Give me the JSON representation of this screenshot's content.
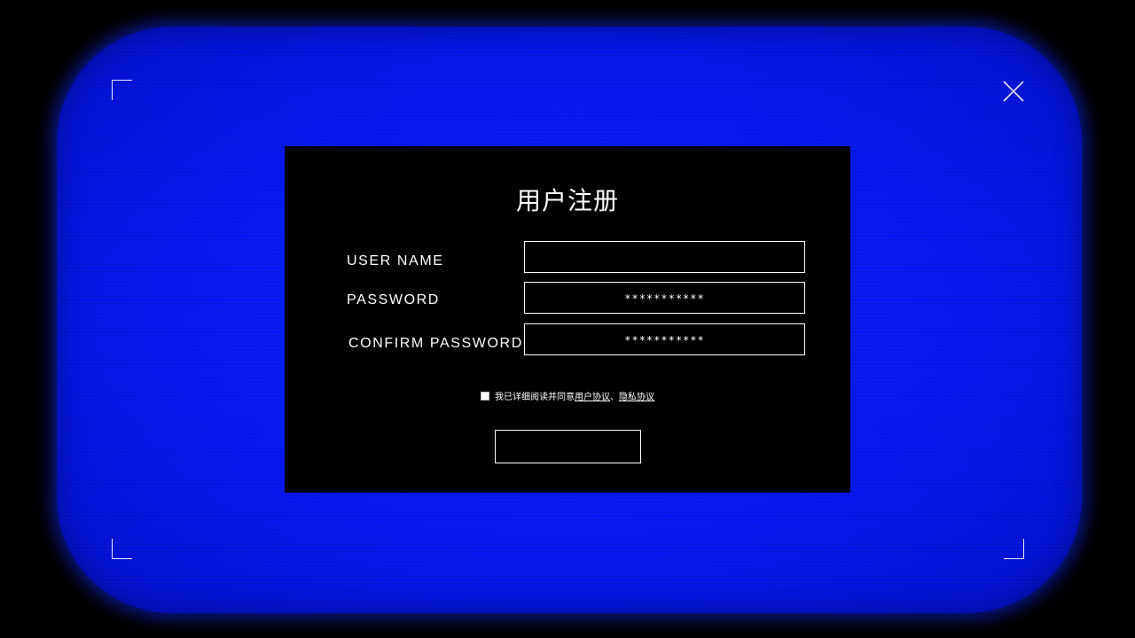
{
  "form": {
    "title": "用户注册",
    "fields": [
      {
        "label": "USER NAME",
        "value": ""
      },
      {
        "label": "PASSWORD",
        "value": "***********"
      },
      {
        "label": "CONFIRM PASSWORD",
        "value": "***********"
      }
    ],
    "agreement": {
      "text": "我已详细阅读并同意",
      "link1": "用户协议",
      "separator": "、",
      "link2": "隐私协议",
      "checked": false
    },
    "submit_label": ""
  },
  "icons": {
    "close": "close-icon",
    "corners": [
      "corner-bracket-top-left",
      "corner-bracket-bottom-left",
      "corner-bracket-bottom-right"
    ]
  },
  "colors": {
    "screen": "#0719f2",
    "panel": "#000000",
    "foreground": "#ffffff"
  }
}
